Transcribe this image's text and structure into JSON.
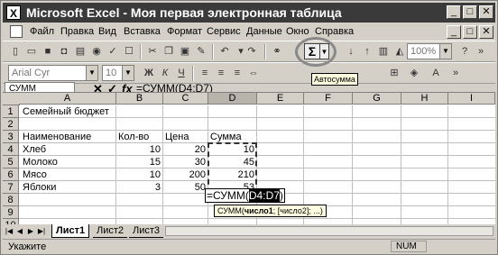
{
  "window": {
    "title": "Microsoft Excel - Моя первая электронная таблица",
    "app_icon_label": "X"
  },
  "menu": {
    "items": [
      "Файл",
      "Правка",
      "Вид",
      "Вставка",
      "Формат",
      "Сервис",
      "Данные",
      "Окно",
      "Справка"
    ]
  },
  "toolbar": {
    "font_name": "Arial Cyr",
    "font_size": "10",
    "zoom": "100%",
    "autosum_symbol": "Σ",
    "autosum_tooltip": "Автосумма"
  },
  "formula_bar": {
    "name_box": "СУММ",
    "cancel_symbol": "✕",
    "enter_symbol": "✓",
    "fx_symbol": "fx",
    "content": "=СУММ(D4:D7)"
  },
  "sheet": {
    "columns": [
      "A",
      "B",
      "C",
      "D",
      "E",
      "F",
      "G",
      "H",
      "I"
    ],
    "rows": [
      "1",
      "2",
      "3",
      "4",
      "5",
      "6",
      "7",
      "8",
      "9",
      "10"
    ],
    "title": "Семейный бюджет",
    "headers": [
      "Наименование",
      "Кол-во",
      "Цена",
      "Сумма"
    ],
    "data": [
      {
        "name": "Хлеб",
        "qty": "10",
        "price": "20",
        "sum": "10"
      },
      {
        "name": "Молоко",
        "qty": "15",
        "price": "30",
        "sum": "45"
      },
      {
        "name": "Мясо",
        "qty": "10",
        "price": "200",
        "sum": "210"
      },
      {
        "name": "Яблоки",
        "qty": "3",
        "price": "50",
        "sum": "53"
      }
    ],
    "edit_formula_prefix": "=СУММ(",
    "edit_formula_range": "D4:D7",
    "edit_formula_suffix": ")",
    "argument_tip_prefix": "СУММ(",
    "argument_tip_bold": "число1",
    "argument_tip_rest": "; [число2]; ...)"
  },
  "tabs": {
    "sheets": [
      "Лист1",
      "Лист2",
      "Лист3"
    ],
    "active": "Лист1"
  },
  "status": {
    "message": "Укажите",
    "num_indicator": "NUM"
  }
}
